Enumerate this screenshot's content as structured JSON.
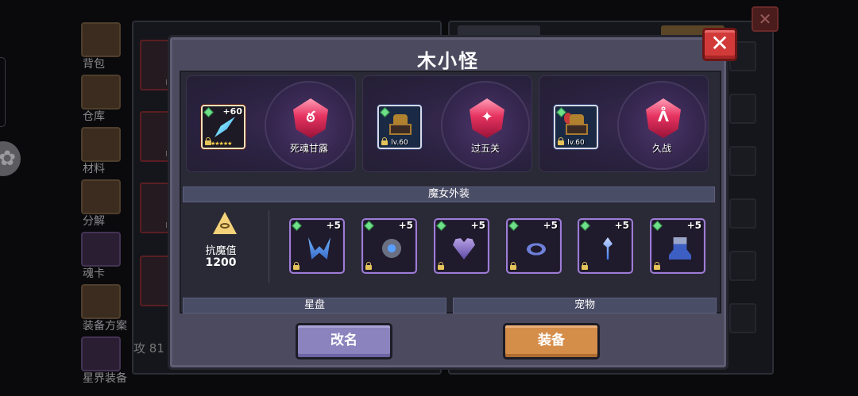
{
  "background": {
    "sidebar": [
      "背包",
      "仓库",
      "材料",
      "分解",
      "魂卡",
      "装备方案",
      "星界装备"
    ],
    "stat_partial": "攻",
    "stat_value_partial": "81",
    "close_glyph": "✕",
    "gear_icon": "✿"
  },
  "modal": {
    "title": "木小怪",
    "close_glyph": "✕",
    "skills": [
      {
        "item_plus": "+60",
        "item_stars": "★★★★★",
        "item_level": "",
        "orb_label": "死魂甘露",
        "orb_mark": "ఠ"
      },
      {
        "item_plus": "",
        "item_stars": "",
        "item_level": "lv.60",
        "orb_label": "过五关",
        "orb_mark": "✦"
      },
      {
        "item_plus": "",
        "item_stars": "",
        "item_level": "lv.60",
        "orb_label": "久战",
        "orb_mark": "ᐰ"
      }
    ],
    "costume_section": "魔女外装",
    "resist_label": "抗魔值",
    "resist_value": "1200",
    "costumes": [
      {
        "plus": "+5",
        "icon": "horns-icon"
      },
      {
        "plus": "+5",
        "icon": "gear-gem-icon"
      },
      {
        "plus": "+5",
        "icon": "heart-icon"
      },
      {
        "plus": "+5",
        "icon": "ring-icon"
      },
      {
        "plus": "+5",
        "icon": "wand-icon"
      },
      {
        "plus": "+5",
        "icon": "boots-icon"
      }
    ],
    "star_chart_label": "星盘",
    "pet_label": "宠物",
    "rename_label": "改名",
    "equip_label": "装备"
  },
  "colors": {
    "modal_bg": "#4b4a5e",
    "close_red": "#d23a3a",
    "rename_purple": "#8a83bd",
    "equip_orange": "#d58d4a",
    "costume_border": "#9e7cd6",
    "crystal_pink": "#e63360"
  }
}
